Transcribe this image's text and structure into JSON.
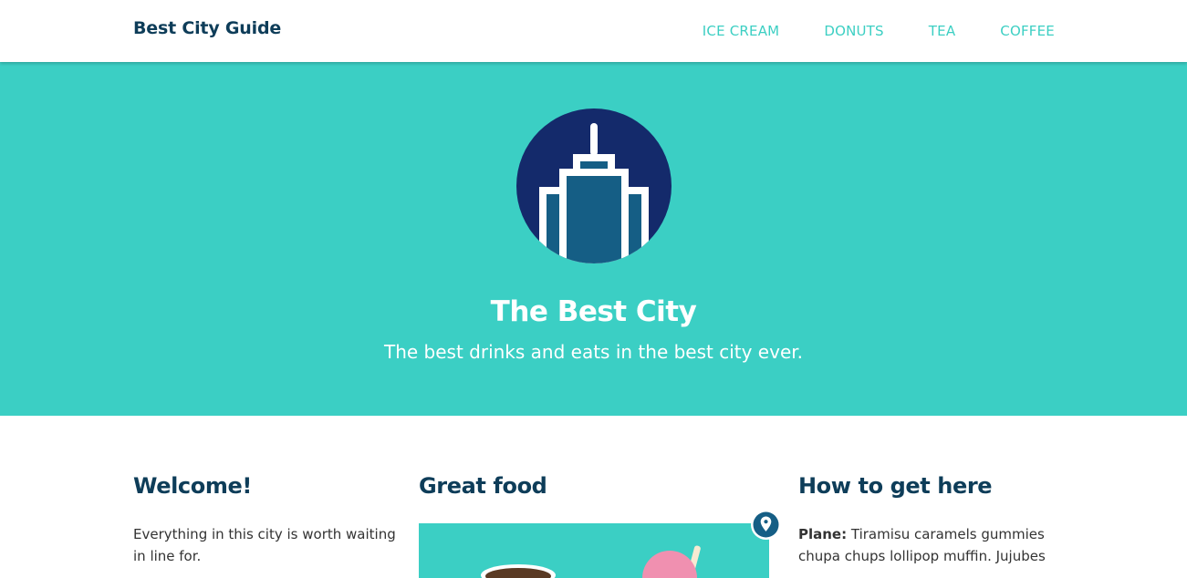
{
  "header": {
    "brand": "Best City Guide",
    "nav": [
      {
        "label": "ICE CREAM"
      },
      {
        "label": "DONUTS"
      },
      {
        "label": "TEA"
      },
      {
        "label": "COFFEE"
      }
    ]
  },
  "hero": {
    "title": "The Best City",
    "subtitle": "The best drinks and eats in the best city ever.",
    "logo_icon": "skyscraper-icon"
  },
  "columns": {
    "welcome": {
      "heading": "Welcome!",
      "text": "Everything in this city is worth waiting in line for."
    },
    "food": {
      "heading": "Great food",
      "image": "coffee-and-ice-cream-illustration",
      "badge_icon": "map-pin-icon"
    },
    "directions": {
      "heading": "How to get here",
      "plane_label": "Plane:",
      "plane_text": "Tiramisu caramels gummies chupa chups lollipop muffin. Jujubes"
    }
  },
  "colors": {
    "teal": "#3bcfc4",
    "navy": "#0e3d59",
    "dark_blue": "#142a6b",
    "building_blue": "#155e85"
  }
}
